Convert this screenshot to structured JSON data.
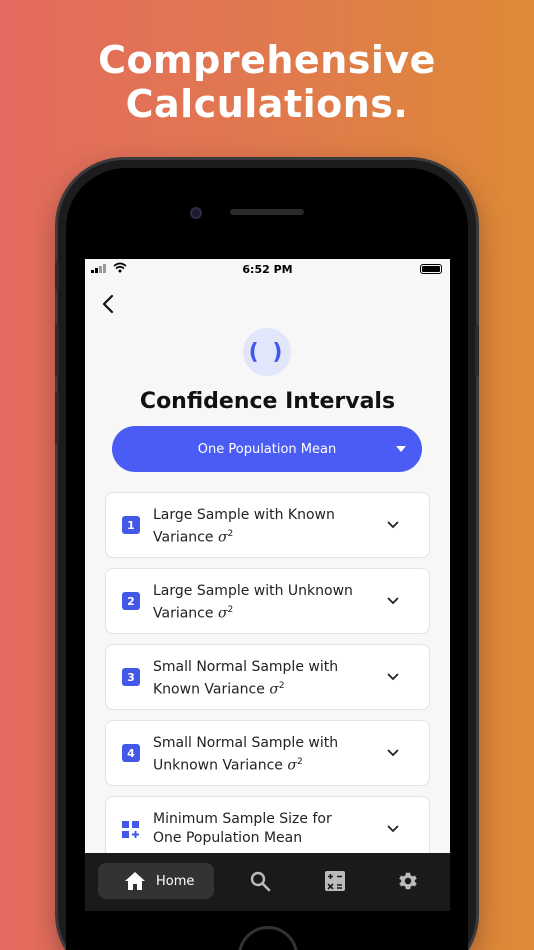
{
  "headline": {
    "line1": "Comprehensive",
    "line2": "Calculations."
  },
  "status_bar": {
    "time": "6:52 PM"
  },
  "screen": {
    "topic_icon_symbol": "( )",
    "title": "Confidence Intervals",
    "dropdown_selected": "One Population Mean"
  },
  "cards": [
    {
      "badge": "1",
      "line1": "Large Sample with Known",
      "line2_prefix": "Variance",
      "symbol": "σ",
      "exponent": "2"
    },
    {
      "badge": "2",
      "line1": "Large Sample with Unknown",
      "line2_prefix": "Variance",
      "symbol": "σ",
      "exponent": "2"
    },
    {
      "badge": "3",
      "line1": "Small Normal Sample with",
      "line2_prefix": "Known Variance",
      "symbol": "σ",
      "exponent": "2"
    },
    {
      "badge": "4",
      "line1": "Small Normal Sample with",
      "line2_prefix": "Unknown Variance",
      "symbol": "σ",
      "exponent": "2"
    },
    {
      "badge_icon": "grid-plus-icon",
      "line1": "Minimum Sample Size for",
      "line2_prefix": "One Population Mean"
    }
  ],
  "tabbar": {
    "home_label": "Home",
    "icons": [
      "home-icon",
      "search-icon",
      "calculator-icon",
      "gear-icon"
    ]
  },
  "colors": {
    "accent": "#4a5cf4",
    "badge": "#4357e9",
    "gradient_start": "#e46b60",
    "gradient_end": "#de8a36"
  }
}
